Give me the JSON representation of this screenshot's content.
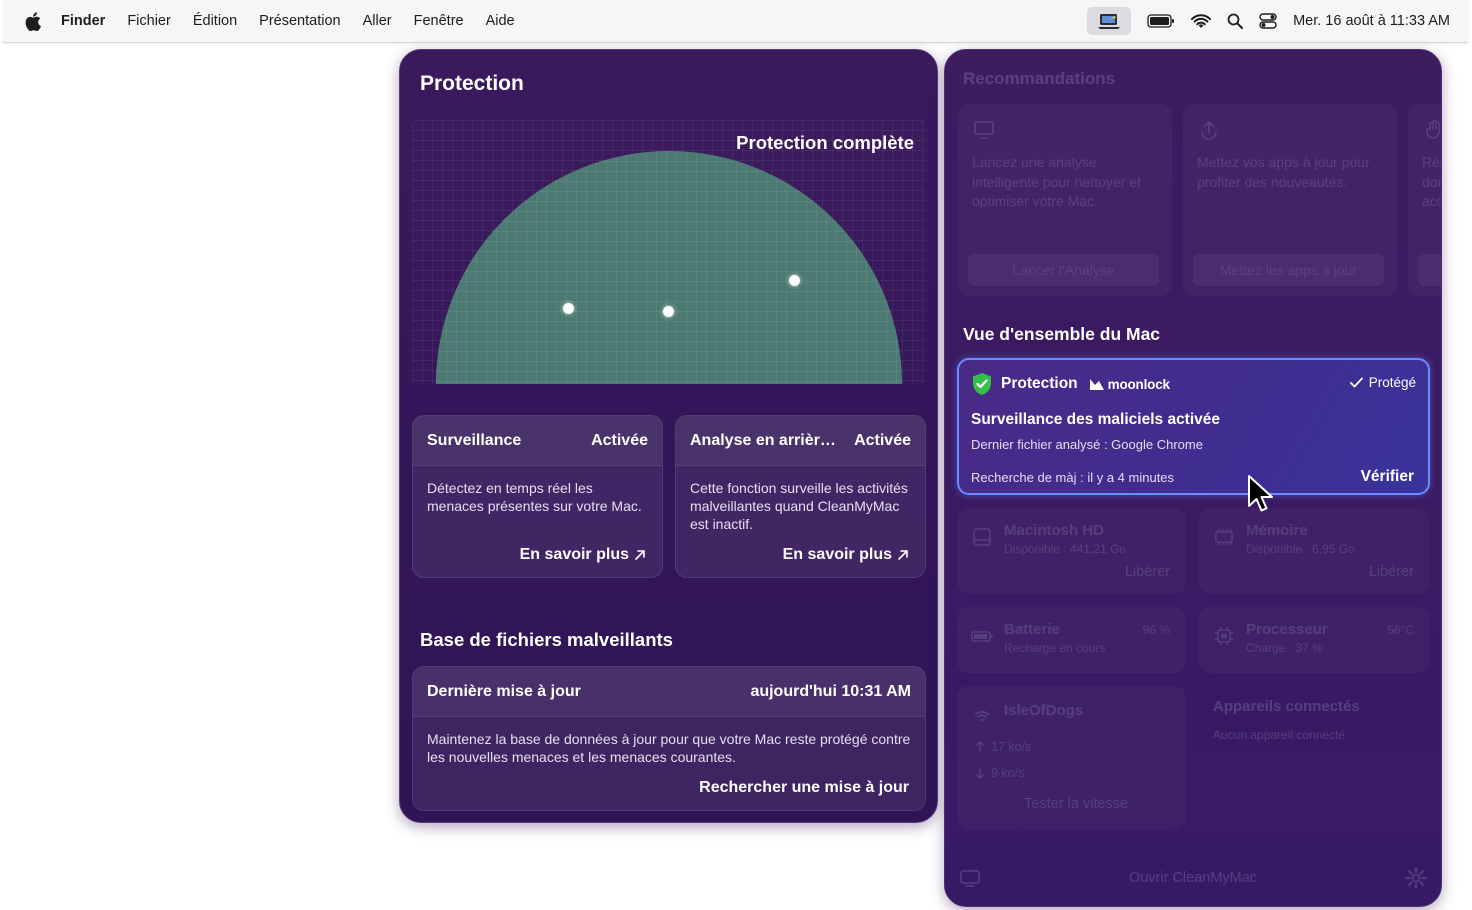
{
  "menubar": {
    "app_name": "Finder",
    "items": [
      "Fichier",
      "Édition",
      "Présentation",
      "Aller",
      "Fenêtre",
      "Aide"
    ],
    "clock": "Mer. 16 août à 11:33 AM"
  },
  "protection": {
    "title": "Protection",
    "visual_label": "Protection complète",
    "monitoring": {
      "name": "Surveillance",
      "state": "Activée",
      "description": "Détectez en temps réel les menaces présentes sur votre Mac.",
      "link": "En savoir plus"
    },
    "background": {
      "name": "Analyse en arrière-plan",
      "state": "Activée",
      "description": "Cette fonction surveille les activités malveillantes quand CleanMyMac est inactif.",
      "link": "En savoir plus"
    },
    "database": {
      "section_title": "Base de fichiers malveillants",
      "name": "Dernière mise à jour",
      "value": "aujourd'hui 10:31 AM",
      "description": "Maintenez la base de données à jour pour que votre Mac reste protégé contre les nouvelles menaces et les menaces courantes.",
      "action": "Rechercher une mise à jour"
    }
  },
  "menu_panel": {
    "recommendations": {
      "title": "Recommandations",
      "cards": [
        {
          "text": "Lancez une analyse intelligente pour nettoyer et optimiser votre Mac.",
          "button": "Lancer l'Analyse"
        },
        {
          "text": "Mettez vos apps à jour pour profiter des nouveautés.",
          "button": "Mettez les apps à jour"
        },
        {
          "text": "Rég don acc",
          "button": ""
        }
      ]
    },
    "overview_title": "Vue d'ensemble du Mac",
    "protection_card": {
      "name": "Protection",
      "brand": "moonlock",
      "status": "Protégé",
      "title": "Surveillance des maliciels activée",
      "last_file": "Dernier fichier analysé : Google Chrome",
      "update_check": "Recherche de màj : il y a 4 minutes",
      "action": "Vérifier"
    },
    "disk": {
      "name": "Macintosh HD",
      "sub": "Disponible : 441,21 Go",
      "action": "Libérer"
    },
    "memory": {
      "name": "Mémoire",
      "sub": "Disponible : 6,95 Go",
      "action": "Libérer"
    },
    "battery": {
      "name": "Batterie",
      "sub": "Recharge en cours",
      "value": "96 %"
    },
    "cpu": {
      "name": "Processeur",
      "sub": "Charge : 37 %",
      "value": "56°C"
    },
    "network": {
      "name": "IsleOfDogs",
      "upload": "17 ko/s",
      "download": "9 ko/s",
      "action": "Tester la vitesse"
    },
    "devices": {
      "name": "Appareils connectés",
      "sub": "Aucun appareil connecté"
    },
    "open_app": "Ouvrir CleanMyMac"
  },
  "colors": {
    "panel_bg": "#3b1a5c",
    "shield_green": "#35c04a",
    "highlight_border": "#6a8cff",
    "dome_green": "#4c7a72"
  }
}
